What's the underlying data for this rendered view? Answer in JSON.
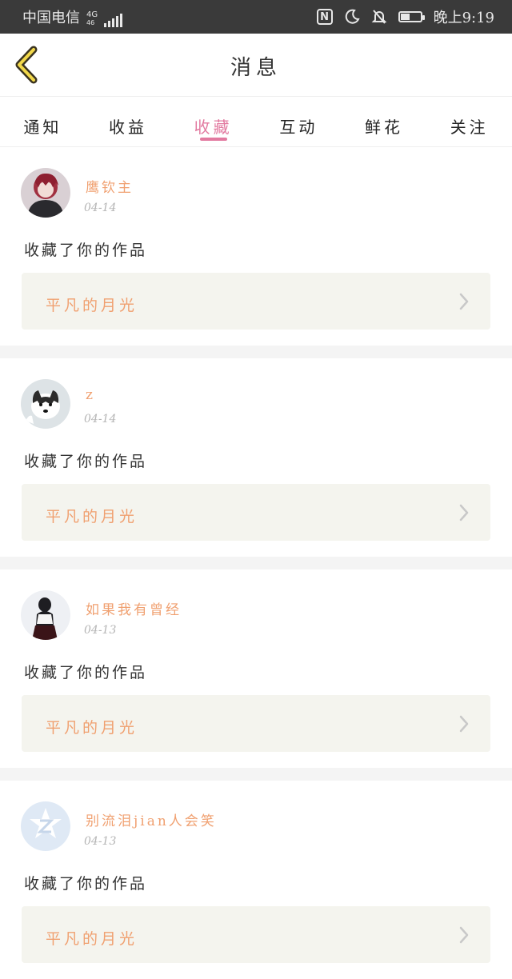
{
  "status_bar": {
    "carrier": "中国电信",
    "network_type": "4G",
    "network_sub": "46",
    "time": "晚上9:19",
    "battery_level_pct": 45
  },
  "header": {
    "title": "消息"
  },
  "tabs": [
    {
      "label": "通知",
      "active": false
    },
    {
      "label": "收益",
      "active": false
    },
    {
      "label": "收藏",
      "active": true
    },
    {
      "label": "互动",
      "active": false
    },
    {
      "label": "鲜花",
      "active": false
    },
    {
      "label": "关注",
      "active": false
    }
  ],
  "messages": [
    {
      "name": "鹰钦主",
      "date": "04-14",
      "action": "收藏了你的作品",
      "work_title": "平凡的月光"
    },
    {
      "name": "z",
      "date": "04-14",
      "action": "收藏了你的作品",
      "work_title": "平凡的月光"
    },
    {
      "name": "如果我有曾经",
      "date": "04-13",
      "action": "收藏了你的作品",
      "work_title": "平凡的月光"
    },
    {
      "name": "别流泪jian人会笑",
      "date": "04-13",
      "action": "收藏了你的作品",
      "work_title": "平凡的月光"
    }
  ],
  "colors": {
    "accent": "#e27aa0",
    "name": "#f0a070",
    "status_bar": "#3a3a3a"
  }
}
